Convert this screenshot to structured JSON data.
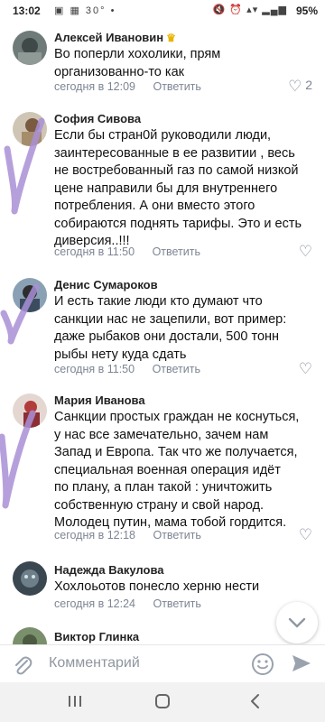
{
  "status_bar": {
    "time": "13:02",
    "temperature": "30°",
    "battery": "95%"
  },
  "comments": [
    {
      "author": "Алексей Ивановин",
      "crown": "♛",
      "text": [
        "Во поперли хохолики, прям",
        "организованно-то как"
      ],
      "time": "сегодня в 12:09",
      "reply": "Ответить",
      "likes": "2"
    },
    {
      "author": "София Сивова",
      "text": [
        "Если бы стран0й руководили люди,",
        "заинтересованные в ее развитии , весь",
        "не востребованный газ по самой низкой",
        "цене направили бы для внутреннего",
        "потребления. А они вместо этого",
        "собираются поднять тарифы. Это и есть",
        "диверсия..!!!"
      ],
      "time": "сегодня в 11:50",
      "reply": "Ответить",
      "likes": ""
    },
    {
      "author": "Денис Сумароков",
      "text": [
        "И есть такие люди кто думают что",
        "санкции нас не зацепили, вот пример:",
        "даже рыбаков они достали, 500 тонн",
        "рыбы нету куда сдать"
      ],
      "time": "сегодня в 11:50",
      "reply": "Ответить",
      "likes": ""
    },
    {
      "author": "Мария Иванова",
      "text": [
        "Санкции простых граждан не коснуться,",
        "у нас все замечательно, зачем нам",
        "Запад и Европа. Так что же получается,",
        "специальная военная операция идёт",
        "по плану, а план такой : уничтожить",
        "собственную страну и свой народ.",
        "Молодец путин, мама тобой гордится."
      ],
      "time": "сегодня в 12:18",
      "reply": "Ответить",
      "likes": ""
    },
    {
      "author": "Надежда Вакулова",
      "text": [
        "Хохлоьотов понесло херню нести"
      ],
      "time": "сегодня в 12:24",
      "reply": "Ответить",
      "likes": ""
    },
    {
      "author": "Виктор Глинка",
      "text": [],
      "time": "",
      "reply": "",
      "likes": ""
    }
  ],
  "input": {
    "placeholder": "Комментарий"
  },
  "icons": [
    "attach-icon",
    "emoji-icon",
    "send-icon",
    "chevron-down-icon",
    "heart-icon",
    "recent-apps-icon",
    "home-icon",
    "back-icon"
  ],
  "colors": {
    "meta": "#7d8593",
    "scribble": "#a98fd6",
    "crown": "#e8b400",
    "send": "#99a2ad"
  }
}
